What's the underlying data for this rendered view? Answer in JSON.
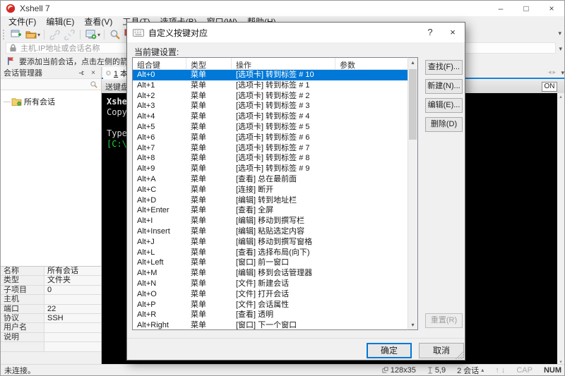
{
  "colors": {
    "accent_blue": "#0078d7",
    "tab_underline": "#1883d7",
    "terminal_bg": "#000000",
    "terminal_green": "#1fd733",
    "chrome_bg": "#f0f0f0",
    "logo_red": "#d02820"
  },
  "window": {
    "title": "Xshell 7",
    "minimize": "–",
    "maximize": "□",
    "close": "×"
  },
  "menubar": {
    "items": [
      "文件(F)",
      "编辑(E)",
      "查看(V)",
      "工具(T)",
      "选项卡(B)",
      "窗口(W)",
      "帮助(H)"
    ]
  },
  "toolbar": {
    "icons": [
      "new-session",
      "open-folder",
      "connect",
      "disconnect",
      "session-dialog",
      "find",
      "layout"
    ]
  },
  "addressbar": {
    "placeholder": "主机.IP地址或会话名称"
  },
  "infobar": {
    "text": "要添加当前会话，点击左侧的箭头按钮。"
  },
  "sidebar": {
    "title": "会话管理器",
    "tree": [
      {
        "label": "所有会话"
      }
    ],
    "properties": [
      {
        "label": "名称",
        "value": "所有会话"
      },
      {
        "label": "类型",
        "value": "文件夹"
      },
      {
        "label": "子项目",
        "value": "0"
      },
      {
        "label": "主机",
        "value": ""
      },
      {
        "label": "端口",
        "value": "22"
      },
      {
        "label": "协议",
        "value": "SSH"
      },
      {
        "label": "用户名",
        "value": ""
      },
      {
        "label": "说明",
        "value": ""
      },
      {
        "label": "",
        "value": ""
      }
    ]
  },
  "tabbar": {
    "tab_number": "1",
    "tab_label": " 本",
    "send_bar_label": "送键盘输",
    "on_button": "ON"
  },
  "terminal": {
    "line1": "Xshell",
    "line2": "Copyri",
    "line3": "",
    "line4": "Type `",
    "prompt": "[C:\\~]",
    "prompt_suffix": "$"
  },
  "statusbar": {
    "left": "未连接。",
    "term_size": "128x35",
    "cursor_pos": "5,9",
    "sessions": "2 会话",
    "cap": "CAP",
    "num": "NUM"
  },
  "dialog": {
    "title": "自定义按键对应",
    "help": "?",
    "close": "×",
    "label": "当前键设置:",
    "table": {
      "columns": [
        "组合键",
        "类型",
        "操作",
        "参数"
      ],
      "rows": [
        {
          "key": "Alt+0",
          "type": "菜单",
          "action": "[选项卡] 转到标签 # 10",
          "param": "",
          "selected": true
        },
        {
          "key": "Alt+1",
          "type": "菜单",
          "action": "[选项卡] 转到标签 # 1",
          "param": ""
        },
        {
          "key": "Alt+2",
          "type": "菜单",
          "action": "[选项卡] 转到标签 # 2",
          "param": ""
        },
        {
          "key": "Alt+3",
          "type": "菜单",
          "action": "[选项卡] 转到标签 # 3",
          "param": ""
        },
        {
          "key": "Alt+4",
          "type": "菜单",
          "action": "[选项卡] 转到标签 # 4",
          "param": ""
        },
        {
          "key": "Alt+5",
          "type": "菜单",
          "action": "[选项卡] 转到标签 # 5",
          "param": ""
        },
        {
          "key": "Alt+6",
          "type": "菜单",
          "action": "[选项卡] 转到标签 # 6",
          "param": ""
        },
        {
          "key": "Alt+7",
          "type": "菜单",
          "action": "[选项卡] 转到标签 # 7",
          "param": ""
        },
        {
          "key": "Alt+8",
          "type": "菜单",
          "action": "[选项卡] 转到标签 # 8",
          "param": ""
        },
        {
          "key": "Alt+9",
          "type": "菜单",
          "action": "[选项卡] 转到标签 # 9",
          "param": ""
        },
        {
          "key": "Alt+A",
          "type": "菜单",
          "action": "[查看] 总在最前面",
          "param": ""
        },
        {
          "key": "Alt+C",
          "type": "菜单",
          "action": "[连接] 断开",
          "param": ""
        },
        {
          "key": "Alt+D",
          "type": "菜单",
          "action": "[编辑] 转到地址栏",
          "param": ""
        },
        {
          "key": "Alt+Enter",
          "type": "菜单",
          "action": "[查看] 全屏",
          "param": ""
        },
        {
          "key": "Alt+I",
          "type": "菜单",
          "action": "[编辑] 移动到撰写栏",
          "param": ""
        },
        {
          "key": "Alt+Insert",
          "type": "菜单",
          "action": "[编辑] 粘贴选定内容",
          "param": ""
        },
        {
          "key": "Alt+J",
          "type": "菜单",
          "action": "[编辑] 移动到撰写窗格",
          "param": ""
        },
        {
          "key": "Alt+L",
          "type": "菜单",
          "action": "[查看] 选择布局(向下)",
          "param": ""
        },
        {
          "key": "Alt+Left",
          "type": "菜单",
          "action": "[窗口] 前一窗口",
          "param": ""
        },
        {
          "key": "Alt+M",
          "type": "菜单",
          "action": "[编辑] 移到会话管理器",
          "param": ""
        },
        {
          "key": "Alt+N",
          "type": "菜单",
          "action": "[文件] 新建会话",
          "param": ""
        },
        {
          "key": "Alt+O",
          "type": "菜单",
          "action": "[文件] 打开会话",
          "param": ""
        },
        {
          "key": "Alt+P",
          "type": "菜单",
          "action": "[文件] 会话属性",
          "param": ""
        },
        {
          "key": "Alt+R",
          "type": "菜单",
          "action": "[查看] 透明",
          "param": ""
        },
        {
          "key": "Alt+Right",
          "type": "菜单",
          "action": "[窗口] 下一个窗口",
          "param": ""
        }
      ]
    },
    "buttons": {
      "find": "查找(F)...",
      "new": "新建(N)...",
      "edit": "编辑(E)...",
      "delete": "删除(D)",
      "reset": "重置(R)",
      "ok": "确定",
      "cancel": "取消"
    }
  }
}
